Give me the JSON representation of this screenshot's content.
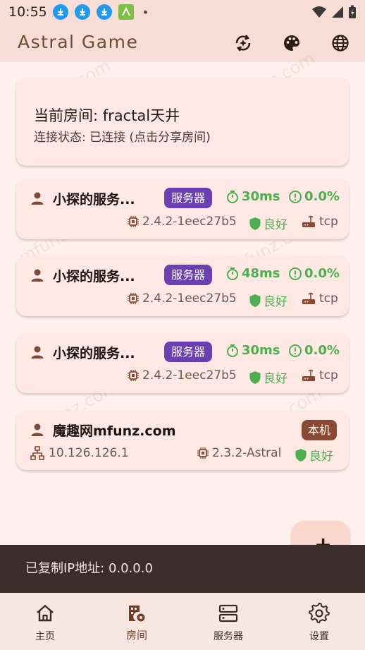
{
  "status_bar": {
    "time": "10:55"
  },
  "app": {
    "title": "Astral Game"
  },
  "room": {
    "title": "当前房间:  fractal天井",
    "status": "连接状态: 已连接 (点击分享房间)"
  },
  "players": [
    {
      "name": "小探的服务...",
      "badge": "服务器",
      "ping": "30ms",
      "loss": "0.0%",
      "version": "2.4.2-1eec27b5",
      "quality": "良好",
      "protocol": "tcp"
    },
    {
      "name": "小探的服务...",
      "badge": "服务器",
      "ping": "48ms",
      "loss": "0.0%",
      "version": "2.4.2-1eec27b5",
      "quality": "良好",
      "protocol": "tcp"
    },
    {
      "name": "小探的服务...",
      "badge": "服务器",
      "ping": "30ms",
      "loss": "0.0%",
      "version": "2.4.2-1eec27b5",
      "quality": "良好",
      "protocol": "tcp"
    }
  ],
  "local_player": {
    "name": "魔趣网mfunz.com",
    "badge": "本机",
    "ip": "10.126.126.1",
    "version": "2.3.2-Astral",
    "quality": "良好"
  },
  "fab": {
    "symbol": "+"
  },
  "snackbar": {
    "text": "已复制IP地址: 0.0.0.0"
  },
  "nav": {
    "items": [
      {
        "label": "主页"
      },
      {
        "label": "房间"
      },
      {
        "label": "服务器"
      },
      {
        "label": "设置"
      }
    ]
  },
  "watermark": "mfunz.com",
  "colors": {
    "accent": "#6f4a34",
    "server_badge": "#6a40b3",
    "local_badge": "#8a4932",
    "good": "#4caf50",
    "snackbar": "#3b2e2b"
  }
}
